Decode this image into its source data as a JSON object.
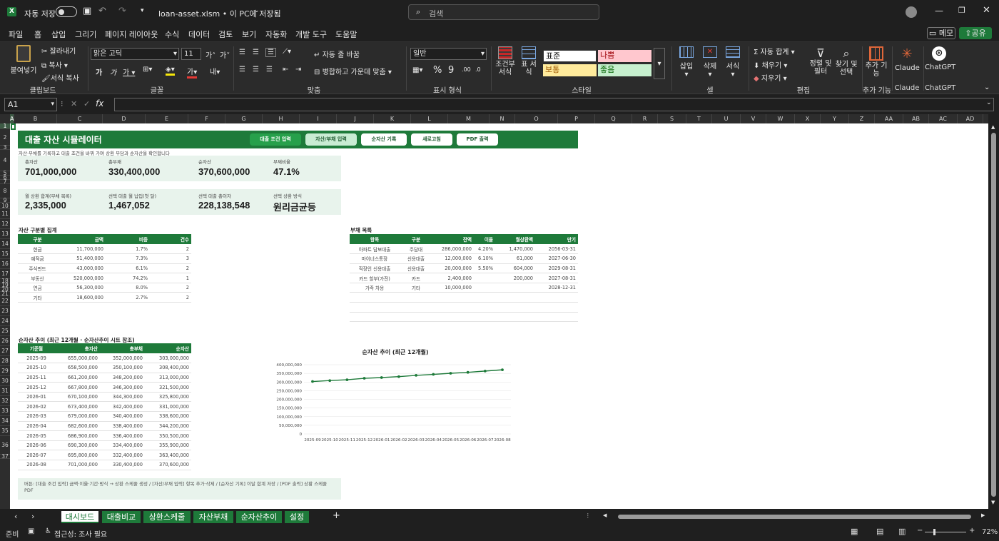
{
  "titlebar": {
    "autosave": "자동 저장",
    "filename": "loan-asset.xlsm • 이 PC에 저장됨",
    "search_placeholder": "검색"
  },
  "menu": [
    "파일",
    "홈",
    "삽입",
    "그리기",
    "페이지 레이아웃",
    "수식",
    "데이터",
    "검토",
    "보기",
    "자동화",
    "개발 도구",
    "도움말"
  ],
  "menu_right": {
    "memo": "메모",
    "share": "공유"
  },
  "ribbon": {
    "clipboard": {
      "paste": "붙여넣기",
      "cut": "잘라내기",
      "copy": "복사",
      "format_painter": "서식 복사",
      "label": "클립보드"
    },
    "font": {
      "name": "맑은 고딕",
      "size": "11",
      "label": "글꼴"
    },
    "align": {
      "wrap": "자동 줄 바꿈",
      "merge": "병합하고 가운데 맞춤",
      "label": "맞춤"
    },
    "number": {
      "format": "일반",
      "label": "표시 형식"
    },
    "styles": {
      "cond": "조건부 서식",
      "table": "표 서식",
      "normal": "표준",
      "bad": "나쁨",
      "neutral": "보통",
      "good": "좋음",
      "label": "스타일"
    },
    "cells": {
      "insert": "삽입",
      "delete": "삭제",
      "format": "서식",
      "label": "셀"
    },
    "edit": {
      "autosum": "자동 합계",
      "fill": "채우기",
      "clear": "지우기",
      "sort": "정렬 및 필터",
      "find": "찾기 및 선택",
      "label": "편집"
    },
    "addins": {
      "add": "추가 기능",
      "label": "추가 기능"
    },
    "claude": {
      "name": "Claude",
      "label": "Claude"
    },
    "chatgpt": {
      "name": "ChatGPT",
      "label": "ChatGPT"
    }
  },
  "namebox": "A1",
  "columns": [
    "A",
    "B",
    "C",
    "D",
    "E",
    "F",
    "G",
    "H",
    "I",
    "J",
    "K",
    "L",
    "M",
    "N",
    "O",
    "P",
    "Q",
    "R",
    "S",
    "T",
    "U",
    "V",
    "W",
    "X",
    "Y",
    "Z",
    "AA",
    "AB",
    "AC",
    "AD",
    "AE"
  ],
  "rows": [
    "1",
    "2",
    "3",
    "4",
    "5",
    "6",
    "7",
    "8",
    "9",
    "10",
    "11",
    "12",
    "13",
    "14",
    "15",
    "16",
    "17",
    "18",
    "19",
    "20",
    "21",
    "22",
    "23",
    "24",
    "25",
    "26",
    "27",
    "28",
    "29",
    "30",
    "31",
    "32",
    "33",
    "34",
    "35",
    "36",
    "37"
  ],
  "dashboard": {
    "title": "대출 자산 시뮬레이터",
    "buttons": [
      "대출 조건 입력",
      "자산/부채 입력",
      "순자산 기록",
      "새로고침",
      "PDF 출력"
    ],
    "subtitle": "자산·부채를 기록하고 대출 조건을 바꿔 가며 상환 부담과 순자산을 확인합니다",
    "kpi1": [
      {
        "label": "총자산",
        "value": "701,000,000"
      },
      {
        "label": "총부채",
        "value": "330,400,000"
      },
      {
        "label": "순자산",
        "value": "370,600,000"
      },
      {
        "label": "부채비율",
        "value": "47.1%"
      }
    ],
    "kpi2": [
      {
        "label": "월 상환 합계(부채 목록)",
        "value": "2,335,000"
      },
      {
        "label": "선택 대출 월 납입(첫 달)",
        "value": "1,467,052"
      },
      {
        "label": "선택 대출 총이자",
        "value": "228,138,548"
      },
      {
        "label": "선택 상환 방식",
        "value": "원리금균등"
      }
    ],
    "asset_title": "자산 구분별 집계",
    "asset_headers": [
      "구분",
      "금액",
      "비중",
      "건수"
    ],
    "assets": [
      [
        "현금",
        "11,700,000",
        "1.7%",
        "2"
      ],
      [
        "예적금",
        "51,400,000",
        "7.3%",
        "3"
      ],
      [
        "주식펀드",
        "43,000,000",
        "6.1%",
        "2"
      ],
      [
        "부동산",
        "520,000,000",
        "74.2%",
        "1"
      ],
      [
        "연금",
        "56,300,000",
        "8.0%",
        "2"
      ],
      [
        "기타",
        "18,600,000",
        "2.7%",
        "2"
      ]
    ],
    "debt_title": "부채 목록",
    "debt_headers": [
      "항목",
      "구분",
      "잔액",
      "이율",
      "월상환액",
      "만기"
    ],
    "debts": [
      [
        "아파트 담보대출",
        "주담대",
        "286,000,000",
        "4.20%",
        "1,470,000",
        "2056-03-31"
      ],
      [
        "마이너스통장",
        "신용대출",
        "12,000,000",
        "6.10%",
        "61,000",
        "2027-06-30"
      ],
      [
        "직장인 신용대출",
        "신용대출",
        "20,000,000",
        "5.50%",
        "604,000",
        "2029-08-31"
      ],
      [
        "카드 할부(가전)",
        "카드",
        "2,400,000",
        "",
        "200,000",
        "2027-08-31"
      ],
      [
        "가족 차용",
        "기타",
        "10,000,000",
        "",
        "",
        "2028-12-31"
      ]
    ],
    "trend_title": "순자산 추이 (최근 12개월 · 순자산추이 시트 참조)",
    "trend_headers": [
      "기준월",
      "총자산",
      "총부채",
      "순자산"
    ],
    "trend": [
      [
        "2025-09",
        "655,000,000",
        "352,000,000",
        "303,000,000"
      ],
      [
        "2025-10",
        "658,500,000",
        "350,100,000",
        "308,400,000"
      ],
      [
        "2025-11",
        "661,200,000",
        "348,200,000",
        "313,000,000"
      ],
      [
        "2025-12",
        "667,800,000",
        "346,300,000",
        "321,500,000"
      ],
      [
        "2026-01",
        "670,100,000",
        "344,300,000",
        "325,800,000"
      ],
      [
        "2026-02",
        "673,400,000",
        "342,400,000",
        "331,000,000"
      ],
      [
        "2026-03",
        "679,000,000",
        "340,400,000",
        "338,600,000"
      ],
      [
        "2026-04",
        "682,600,000",
        "338,400,000",
        "344,200,000"
      ],
      [
        "2026-05",
        "686,900,000",
        "336,400,000",
        "350,500,000"
      ],
      [
        "2026-06",
        "690,300,000",
        "334,400,000",
        "355,900,000"
      ],
      [
        "2026-07",
        "695,800,000",
        "332,400,000",
        "363,400,000"
      ],
      [
        "2026-08",
        "701,000,000",
        "330,400,000",
        "370,600,000"
      ]
    ],
    "note": "버튼: [대출 조건 입력] 금액·이율·기간·방식 → 상환 스케줄 생성 / [자산/부채 입력] 항목 추가·삭제 / [순자산 기록] 이달 합계 저장 / [PDF 출력] 상황 스케줄 PDF"
  },
  "chart_data": {
    "type": "line",
    "title": "순자산 추이 (최근 12개월)",
    "categories": [
      "2025-09",
      "2025-10",
      "2025-11",
      "2025-12",
      "2026-01",
      "2026-02",
      "2026-03",
      "2026-04",
      "2026-05",
      "2026-06",
      "2026-07",
      "2026-08"
    ],
    "series": [
      {
        "values": [
          303000000,
          308400000,
          313000000,
          321500000,
          325800000,
          331000000,
          338600000,
          344200000,
          350500000,
          355900000,
          363400000,
          370600000
        ]
      }
    ],
    "ylim": [
      0,
      400000000
    ],
    "yticks": [
      "400,000,000",
      "350,000,000",
      "300,000,000",
      "250,000,000",
      "200,000,000",
      "150,000,000",
      "100,000,000",
      "50,000,000",
      "0"
    ],
    "color": "#1e7a3a"
  },
  "tabs": [
    "대시보드",
    "대출비교",
    "상환스케줄",
    "자산부채",
    "순자산추이",
    "설정"
  ],
  "status": {
    "ready": "준비",
    "accessibility": "접근성: 조사 필요",
    "zoom": "72%"
  }
}
